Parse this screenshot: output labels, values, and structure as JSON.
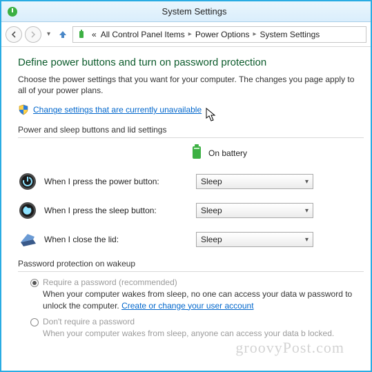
{
  "titlebar": {
    "title": "System Settings"
  },
  "breadcrumb": {
    "prefix": "«",
    "items": [
      "All Control Panel Items",
      "Power Options",
      "System Settings"
    ]
  },
  "main": {
    "heading": "Define power buttons and turn on password protection",
    "desc": "Choose the power settings that you want for your computer. The changes you page apply to all of your power plans.",
    "change_link": "Change settings that are currently unavailable",
    "group1_title": "Power and sleep buttons and lid settings",
    "battery_label": "On battery",
    "rows": [
      {
        "label": "When I press the power button:",
        "value": "Sleep"
      },
      {
        "label": "When I press the sleep button:",
        "value": "Sleep"
      },
      {
        "label": "When I close the lid:",
        "value": "Sleep"
      }
    ],
    "group2_title": "Password protection on wakeup",
    "pw_options": [
      {
        "label": "Require a password (recommended)",
        "desc_a": "When your computer wakes from sleep, no one can access your data w password to unlock the computer. ",
        "link": "Create or change your user account"
      },
      {
        "label": "Don't require a password",
        "desc": "When your computer wakes from sleep, anyone can access your data b locked."
      }
    ]
  },
  "watermark": "groovyPost.com"
}
